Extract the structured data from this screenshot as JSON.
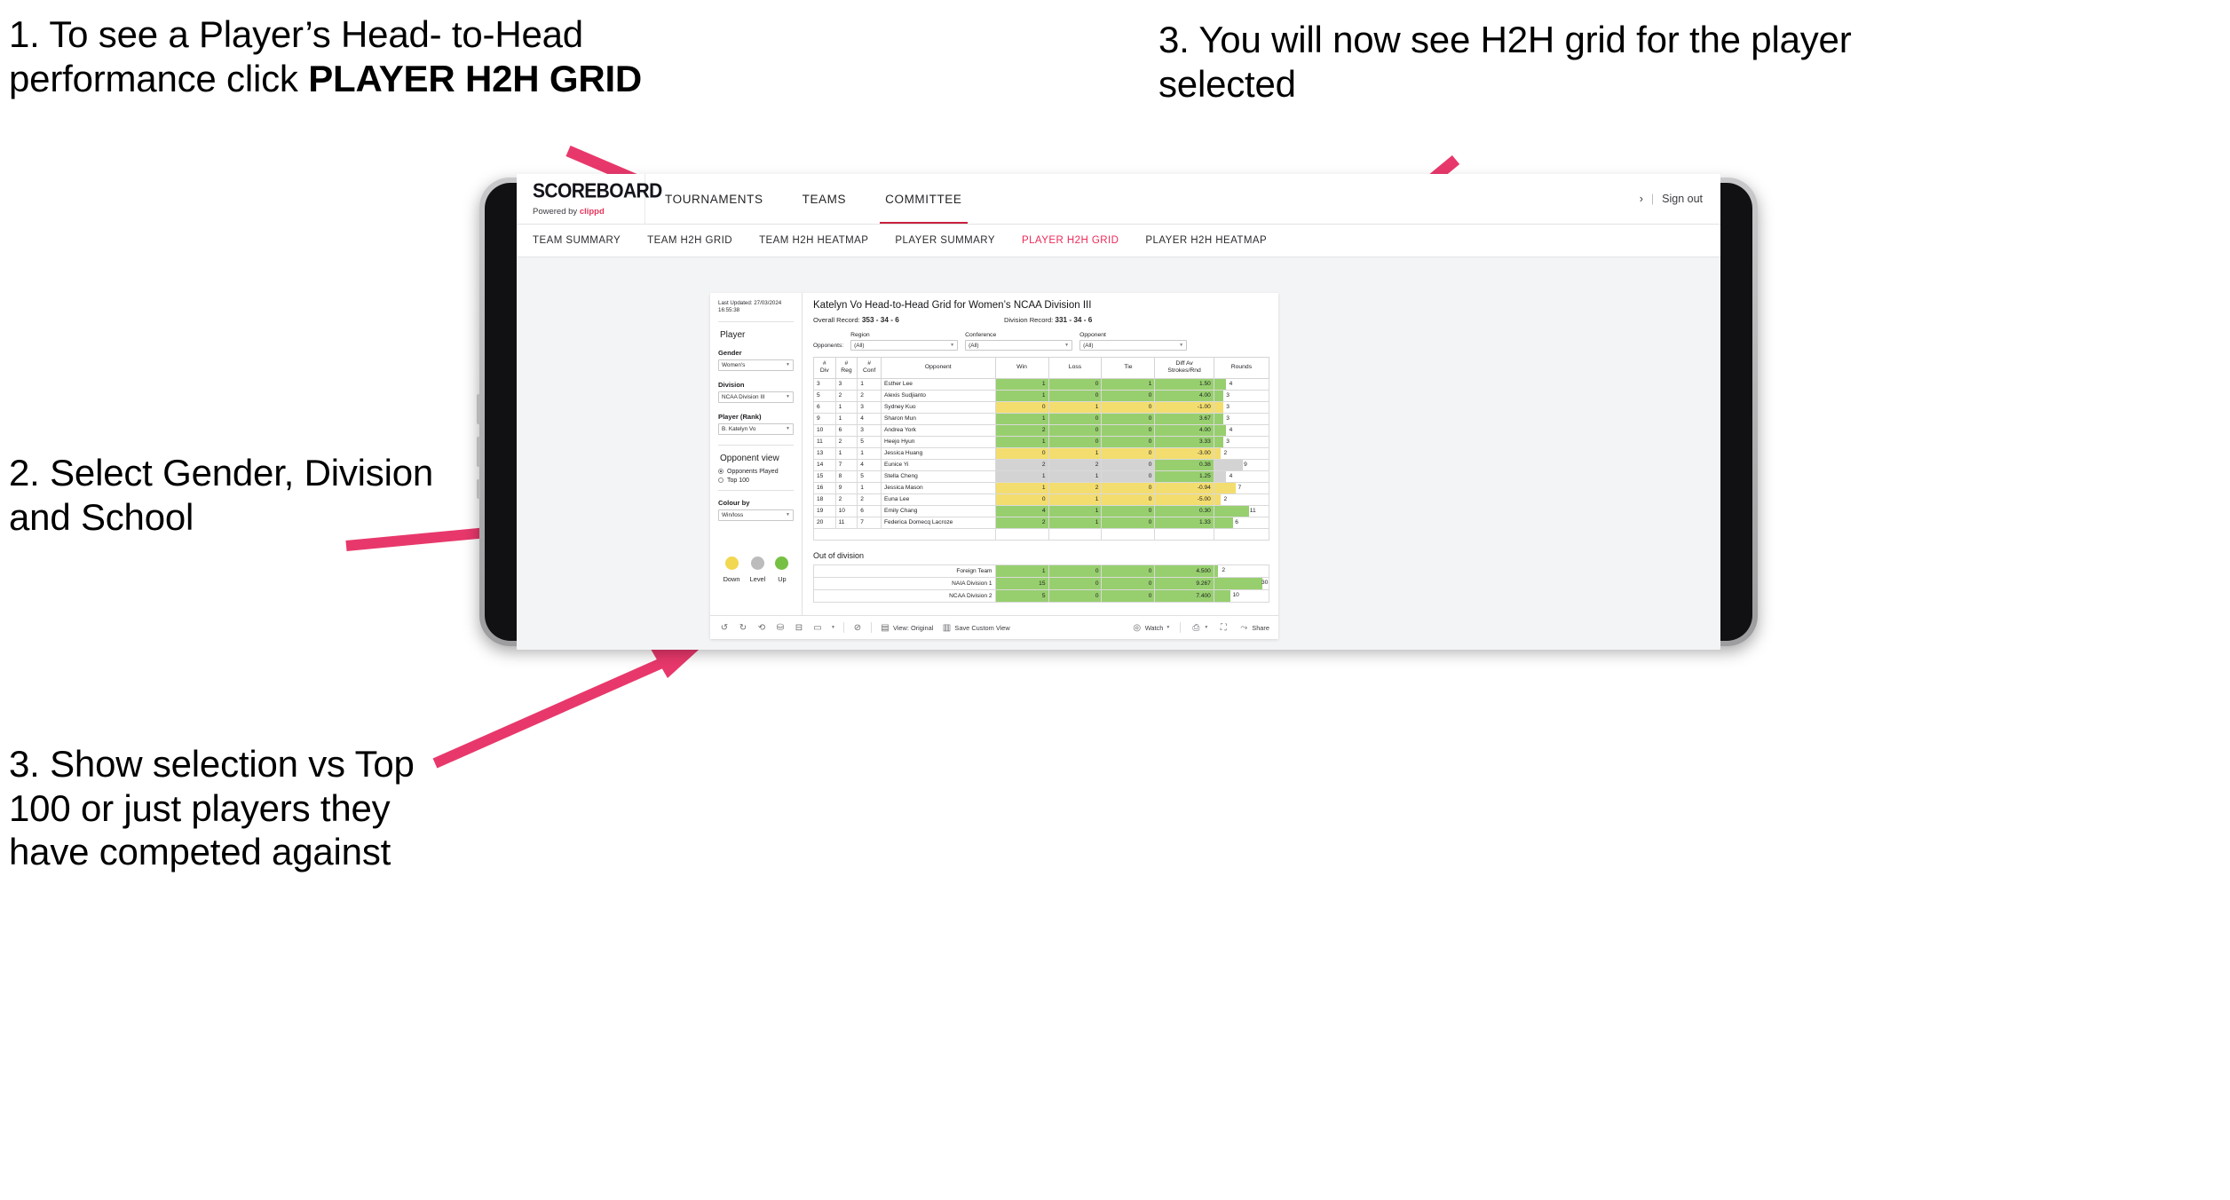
{
  "callouts": {
    "one_a": "1. To see a Player’s Head-",
    "one_b": "to-Head performance click ",
    "one_bold": "PLAYER H2H GRID",
    "two": "2. Select Gender, Division and School",
    "three": "3. Show selection vs Top 100 or just players they have competed against",
    "four": "3. You will now see H2H grid for the player selected"
  },
  "brand": {
    "title": "SCOREBOARD",
    "powered_prefix": "Powered by ",
    "powered_name": "clippd"
  },
  "topnav": {
    "items": [
      {
        "label": "TOURNAMENTS",
        "active": false
      },
      {
        "label": "TEAMS",
        "active": false
      },
      {
        "label": "COMMITTEE",
        "active": true
      }
    ],
    "chevron": "›",
    "separator": "|",
    "signout": "Sign out"
  },
  "subnav": {
    "items": [
      {
        "label": "TEAM SUMMARY",
        "active": false
      },
      {
        "label": "TEAM H2H GRID",
        "active": false
      },
      {
        "label": "TEAM H2H HEATMAP",
        "active": false
      },
      {
        "label": "PLAYER SUMMARY",
        "active": false
      },
      {
        "label": "PLAYER H2H GRID",
        "active": true
      },
      {
        "label": "PLAYER H2H HEATMAP",
        "active": false
      }
    ],
    "accent_color": "#ec2a58"
  },
  "sidebar": {
    "last_updated": "Last Updated: 27/03/2024 16:55:38",
    "section_player": "Player",
    "filters": [
      {
        "label": "Gender",
        "value": "Women's"
      },
      {
        "label": "Division",
        "value": "NCAA Division III"
      },
      {
        "label": "Player (Rank)",
        "value": "B. Katelyn Vo"
      }
    ],
    "opponent_view": {
      "title": "Opponent view",
      "options": [
        {
          "label": "Opponents Played",
          "selected": true
        },
        {
          "label": "Top 100",
          "selected": false
        }
      ]
    },
    "colour_by": {
      "label": "Colour by",
      "value": "Win/loss"
    },
    "legend": [
      {
        "label": "Down",
        "color": "#f2d750"
      },
      {
        "label": "Level",
        "color": "#bcbcbc"
      },
      {
        "label": "Up",
        "color": "#76c043"
      }
    ]
  },
  "viz": {
    "title": "Katelyn Vo Head-to-Head Grid for Women’s NCAA Division III",
    "overall_record_label": "Overall Record: ",
    "overall_record_value": "353 - 34 - 6",
    "division_record_label": "Division Record: ",
    "division_record_value": "331 - 34 - 6",
    "opponents_label": "Opponents:",
    "opponent_filters": [
      {
        "label": "Region",
        "value": "(All)"
      },
      {
        "label": "Conference",
        "value": "(All)"
      },
      {
        "label": "Opponent",
        "value": "(All)"
      }
    ],
    "columns": [
      "# Div",
      "# Reg",
      "# Conf",
      "Opponent",
      "Win",
      "Loss",
      "Tie",
      "Diff Av Strokes/Rnd",
      "Rounds"
    ],
    "rows": [
      {
        "div": "3",
        "reg": "3",
        "conf": "1",
        "opponent": "Esther Lee",
        "win": "1",
        "loss": "0",
        "tie": "1",
        "diff": "1.50",
        "rounds": "4",
        "status": "green",
        "bar_pct": 22
      },
      {
        "div": "5",
        "reg": "2",
        "conf": "2",
        "opponent": "Alexis Sudjianto",
        "win": "1",
        "loss": "0",
        "tie": "0",
        "diff": "4.00",
        "rounds": "3",
        "status": "green",
        "bar_pct": 16
      },
      {
        "div": "6",
        "reg": "1",
        "conf": "3",
        "opponent": "Sydney Kuo",
        "win": "0",
        "loss": "1",
        "tie": "0",
        "diff": "-1.00",
        "rounds": "3",
        "status": "yellow",
        "bar_pct": 16
      },
      {
        "div": "9",
        "reg": "1",
        "conf": "4",
        "opponent": "Sharon Mun",
        "win": "1",
        "loss": "0",
        "tie": "0",
        "diff": "3.67",
        "rounds": "3",
        "status": "green",
        "bar_pct": 16
      },
      {
        "div": "10",
        "reg": "6",
        "conf": "3",
        "opponent": "Andrea York",
        "win": "2",
        "loss": "0",
        "tie": "0",
        "diff": "4.00",
        "rounds": "4",
        "status": "green",
        "bar_pct": 22
      },
      {
        "div": "11",
        "reg": "2",
        "conf": "5",
        "opponent": "Heejo Hyun",
        "win": "1",
        "loss": "0",
        "tie": "0",
        "diff": "3.33",
        "rounds": "3",
        "status": "green",
        "bar_pct": 16
      },
      {
        "div": "13",
        "reg": "1",
        "conf": "1",
        "opponent": "Jessica Huang",
        "win": "0",
        "loss": "1",
        "tie": "0",
        "diff": "-3.00",
        "rounds": "2",
        "status": "yellow",
        "bar_pct": 11
      },
      {
        "div": "14",
        "reg": "7",
        "conf": "4",
        "opponent": "Eunice Yi",
        "win": "2",
        "loss": "2",
        "tie": "0",
        "diff": "0.38",
        "rounds": "9",
        "status": "grey",
        "bar_pct": 52,
        "diff_status": "green"
      },
      {
        "div": "15",
        "reg": "8",
        "conf": "5",
        "opponent": "Stella Cheng",
        "win": "1",
        "loss": "1",
        "tie": "0",
        "diff": "1.25",
        "rounds": "4",
        "status": "grey",
        "bar_pct": 22,
        "diff_status": "green"
      },
      {
        "div": "16",
        "reg": "9",
        "conf": "1",
        "opponent": "Jessica Mason",
        "win": "1",
        "loss": "2",
        "tie": "0",
        "diff": "-0.94",
        "rounds": "7",
        "status": "yellow",
        "bar_pct": 40
      },
      {
        "div": "18",
        "reg": "2",
        "conf": "2",
        "opponent": "Euna Lee",
        "win": "0",
        "loss": "1",
        "tie": "0",
        "diff": "-5.00",
        "rounds": "2",
        "status": "yellow",
        "bar_pct": 11
      },
      {
        "div": "19",
        "reg": "10",
        "conf": "6",
        "opponent": "Emily Chang",
        "win": "4",
        "loss": "1",
        "tie": "0",
        "diff": "0.30",
        "rounds": "11",
        "status": "green",
        "bar_pct": 64
      },
      {
        "div": "20",
        "reg": "11",
        "conf": "7",
        "opponent": "Federica Domecq Lacroze",
        "win": "2",
        "loss": "1",
        "tie": "0",
        "diff": "1.33",
        "rounds": "6",
        "status": "green",
        "bar_pct": 34
      }
    ],
    "out_of_division": {
      "title": "Out of division",
      "rows": [
        {
          "name": "Foreign Team",
          "win": "1",
          "loss": "0",
          "tie": "0",
          "diff": "4.500",
          "rounds": "2",
          "status": "green",
          "bar_pct": 7
        },
        {
          "name": "NAIA Division 1",
          "win": "15",
          "loss": "0",
          "tie": "0",
          "diff": "9.267",
          "rounds": "30",
          "status": "green",
          "bar_pct": 88
        },
        {
          "name": "NCAA Division 2",
          "win": "5",
          "loss": "0",
          "tie": "0",
          "diff": "7.400",
          "rounds": "10",
          "status": "green",
          "bar_pct": 29
        }
      ]
    }
  },
  "toolbar": {
    "view_label": "View: Original",
    "save_label": "Save Custom View",
    "watch_label": "Watch",
    "share_label": "Share"
  },
  "colors": {
    "accent": "#ec2a58",
    "arrow": "#e8386b",
    "green": "#97cf6e",
    "yellow": "#f3dd6e",
    "grey": "#d3d3d3"
  }
}
